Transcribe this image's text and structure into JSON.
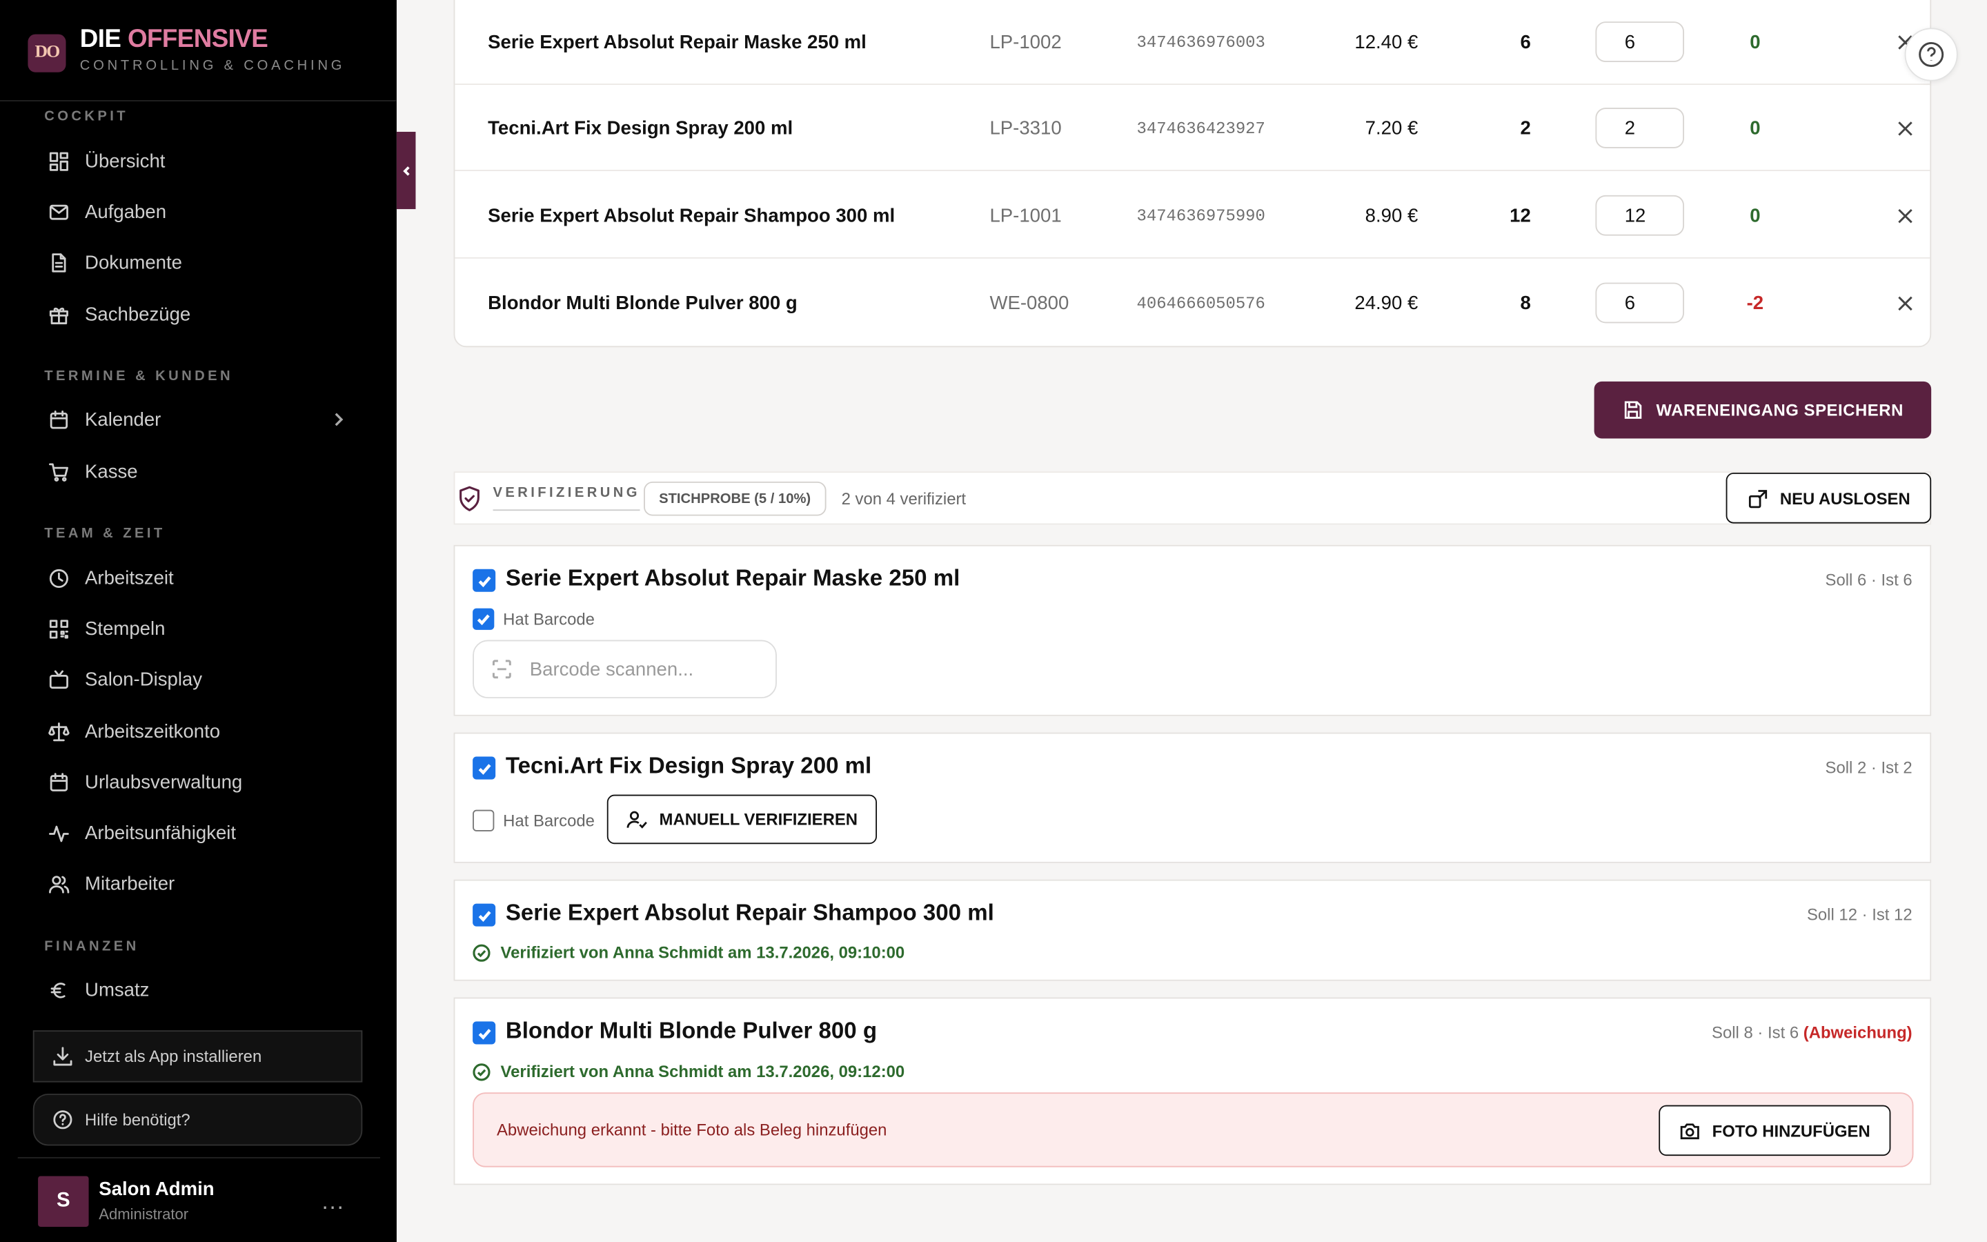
{
  "brand": {
    "logo": "DO",
    "title_main": "DIE",
    "title_accent": "OFFENSIVE",
    "subtitle": "CONTROLLING & COACHING",
    "accent_color": "#5a2140"
  },
  "sidebar": {
    "sections": [
      {
        "label": "COCKPIT",
        "items": [
          {
            "label": "Übersicht",
            "icon": "dashboard-icon"
          },
          {
            "label": "Aufgaben",
            "icon": "mail-icon"
          },
          {
            "label": "Dokumente",
            "icon": "document-icon"
          },
          {
            "label": "Sachbezüge",
            "icon": "gift-icon"
          }
        ]
      },
      {
        "label": "TERMINE & KUNDEN",
        "items": [
          {
            "label": "Kalender",
            "icon": "calendar-icon"
          },
          {
            "label": "Kasse",
            "icon": "cart-icon"
          }
        ]
      },
      {
        "label": "TEAM & ZEIT",
        "items": [
          {
            "label": "Arbeitszeit",
            "icon": "clock-icon"
          },
          {
            "label": "Stempeln",
            "icon": "qr-icon"
          },
          {
            "label": "Salon-Display",
            "icon": "tv-icon"
          },
          {
            "label": "Arbeitszeitkonto",
            "icon": "scale-icon"
          },
          {
            "label": "Urlaubsverwaltung",
            "icon": "calendar-icon"
          },
          {
            "label": "Arbeitsunfähigkeit",
            "icon": "pulse-icon"
          },
          {
            "label": "Mitarbeiter",
            "icon": "users-icon"
          }
        ]
      },
      {
        "label": "FINANZEN",
        "items": [
          {
            "label": "Umsatz",
            "icon": "euro-icon"
          }
        ]
      }
    ],
    "install_label": "Jetzt als App installieren",
    "help_label": "Hilfe benötigt?",
    "user": {
      "initial": "S",
      "name": "Salon Admin",
      "role": "Administrator",
      "more": "..."
    }
  },
  "products": [
    {
      "name": "Serie Expert Absolut Repair Maske 250 ml",
      "sku": "LP-1002",
      "ean": "3474636976003",
      "price": "12.40 €",
      "soll": "6",
      "ist": "6",
      "diff": "0"
    },
    {
      "name": "Tecni.Art Fix Design Spray 200 ml",
      "sku": "LP-3310",
      "ean": "3474636423927",
      "price": "7.20 €",
      "soll": "2",
      "ist": "2",
      "diff": "0"
    },
    {
      "name": "Serie Expert Absolut Repair Shampoo 300 ml",
      "sku": "LP-1001",
      "ean": "3474636975990",
      "price": "8.90 €",
      "soll": "12",
      "ist": "12",
      "diff": "0"
    },
    {
      "name": "Blondor Multi Blonde Pulver 800 g",
      "sku": "WE-0800",
      "ean": "4064666050576",
      "price": "24.90 €",
      "soll": "8",
      "ist": "6",
      "diff": "-2"
    }
  ],
  "save_label": "WARENEINGANG SPEICHERN",
  "verification": {
    "label": "VERIFIZIERUNG",
    "sample_badge": "STICHPROBE (5 / 10%)",
    "count": "2 von 4 verifiziert",
    "reroll_label": "NEU AUSLOSEN",
    "cards": [
      {
        "title": "Serie Expert Absolut Repair Maske 250 ml",
        "meta": "Soll 6 · Ist 6",
        "has_barcode_label": "Hat Barcode",
        "scan_placeholder": "Barcode scannen..."
      },
      {
        "title": "Tecni.Art Fix Design Spray 200 ml",
        "meta": "Soll 2 · Ist 2",
        "has_barcode_label": "Hat Barcode",
        "manual_label": "MANUELL VERIFIZIEREN"
      },
      {
        "title": "Serie Expert Absolut Repair Shampoo 300 ml",
        "meta": "Soll 12 · Ist 12",
        "verified_text": "Verifiziert von Anna Schmidt am 13.7.2026, 09:10:00"
      },
      {
        "title": "Blondor Multi Blonde Pulver 800 g",
        "meta": "Soll 8 · Ist 6",
        "deviation": "(Abweichung)",
        "verified_text": "Verifiziert von Anna Schmidt am 13.7.2026, 09:12:00",
        "deviation_text": "Abweichung erkannt - bitte Foto als Beleg hinzufügen",
        "photo_label": "FOTO HINZUFÜGEN"
      }
    ]
  },
  "colors": {
    "positive": "#2d6a2d",
    "negative": "#c62828",
    "checkbox": "#1a73e8"
  }
}
